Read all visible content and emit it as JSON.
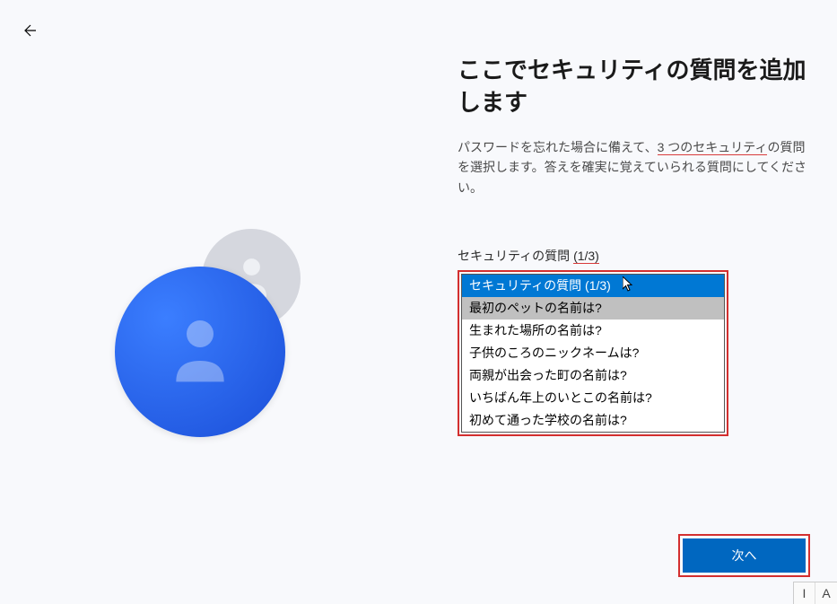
{
  "nav": {
    "back": "戻る"
  },
  "page": {
    "title": "ここでセキュリティの質問を追加します",
    "description_part1": "パスワードを忘れた場合に備えて、",
    "description_highlight": "3 つのセキュリティ",
    "description_part2": "の質問を選択します。答えを確実に覚えていられる質問にしてください。"
  },
  "question": {
    "label_prefix": "セキュリティの質問 ",
    "label_count": "(1/3)",
    "selected": "セキュリティの質問 (1/3)",
    "options": [
      "最初のペットの名前は?",
      "生まれた場所の名前は?",
      "子供のころのニックネームは?",
      "両親が出会った町の名前は?",
      "いちばん年上のいとこの名前は?",
      "初めて通った学校の名前は?"
    ],
    "hovered_index": 0
  },
  "buttons": {
    "next": "次へ"
  },
  "ime": {
    "left": "I",
    "right": "A"
  }
}
